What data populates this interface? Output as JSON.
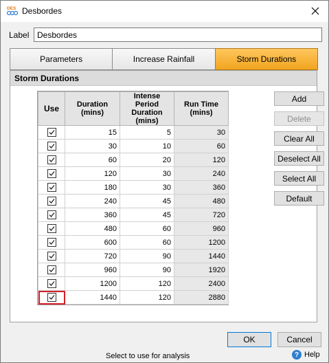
{
  "window": {
    "title": "Desbordes",
    "app_icon_text": "DES"
  },
  "label": {
    "caption": "Label",
    "value": "Desbordes"
  },
  "tabs": [
    {
      "label": "Parameters",
      "active": false
    },
    {
      "label": "Increase Rainfall",
      "active": false
    },
    {
      "label": "Storm Durations",
      "active": true
    }
  ],
  "panel": {
    "header": "Storm Durations"
  },
  "grid": {
    "columns": [
      "Use",
      "Duration (mins)",
      "Intense Period Duration (mins)",
      "Run Time (mins)"
    ],
    "rows": [
      {
        "use": true,
        "duration": "15",
        "intense": "5",
        "runtime": "30"
      },
      {
        "use": true,
        "duration": "30",
        "intense": "10",
        "runtime": "60"
      },
      {
        "use": true,
        "duration": "60",
        "intense": "20",
        "runtime": "120"
      },
      {
        "use": true,
        "duration": "120",
        "intense": "30",
        "runtime": "240"
      },
      {
        "use": true,
        "duration": "180",
        "intense": "30",
        "runtime": "360"
      },
      {
        "use": true,
        "duration": "240",
        "intense": "45",
        "runtime": "480"
      },
      {
        "use": true,
        "duration": "360",
        "intense": "45",
        "runtime": "720"
      },
      {
        "use": true,
        "duration": "480",
        "intense": "60",
        "runtime": "960"
      },
      {
        "use": true,
        "duration": "600",
        "intense": "60",
        "runtime": "1200"
      },
      {
        "use": true,
        "duration": "720",
        "intense": "90",
        "runtime": "1440"
      },
      {
        "use": true,
        "duration": "960",
        "intense": "90",
        "runtime": "1920"
      },
      {
        "use": true,
        "duration": "1200",
        "intense": "120",
        "runtime": "2400"
      },
      {
        "use": true,
        "duration": "1440",
        "intense": "120",
        "runtime": "2880",
        "highlighted": true
      }
    ]
  },
  "side_buttons": {
    "add": "Add",
    "delete": "Delete",
    "clear_all": "Clear All",
    "deselect_all": "Deselect All",
    "select_all": "Select All",
    "default": "Default"
  },
  "footer": {
    "ok": "OK",
    "cancel": "Cancel",
    "status": "Select to use for analysis",
    "help": "Help"
  },
  "colors": {
    "active_tab": "#f2a51e",
    "selection_outline": "#d4202a",
    "help_icon": "#2f7fd0"
  }
}
